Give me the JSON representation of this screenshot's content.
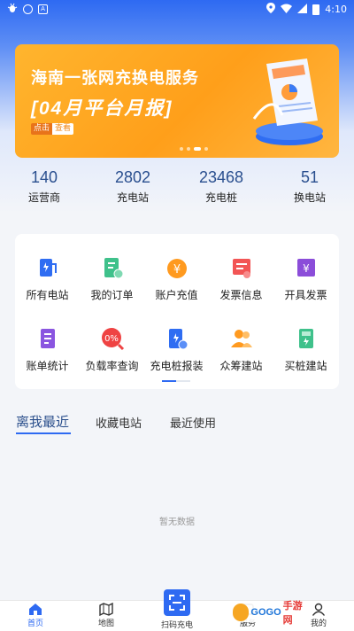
{
  "status_bar": {
    "left_icons": [
      "bug-icon",
      "circle-app-icon",
      "a-notification-icon"
    ],
    "right_icons": [
      "location-icon",
      "wifi-icon",
      "signal-icon",
      "battery-icon"
    ],
    "time": "4:10"
  },
  "banner": {
    "title": "海南一张网充换电服务",
    "subtitle": "[04月平台月报]",
    "tag_left": "点击",
    "tag_right": "查看",
    "slide_count": 4,
    "active_slide": 3
  },
  "stats": [
    {
      "value": "140",
      "label": "运营商"
    },
    {
      "value": "2802",
      "label": "充电站"
    },
    {
      "value": "23468",
      "label": "充电桩"
    },
    {
      "value": "51",
      "label": "换电站"
    }
  ],
  "menu": {
    "items": [
      {
        "label": "所有电站",
        "icon": "charging-station-icon",
        "color": "#2f6df2"
      },
      {
        "label": "我的订单",
        "icon": "order-icon",
        "color": "#3fc18b"
      },
      {
        "label": "账户充值",
        "icon": "yuan-coin-icon",
        "color": "#ff9a1f"
      },
      {
        "label": "发票信息",
        "icon": "invoice-icon",
        "color": "#f25555"
      },
      {
        "label": "开具发票",
        "icon": "issue-invoice-icon",
        "color": "#8b4dd9"
      },
      {
        "label": "账单统计",
        "icon": "bill-stats-icon",
        "color": "#8a55e0"
      },
      {
        "label": "负载率查询",
        "icon": "percent-icon",
        "color": "#ef4343"
      },
      {
        "label": "充电桩报装",
        "icon": "pile-install-icon",
        "color": "#2f6df2"
      },
      {
        "label": "众筹建站",
        "icon": "crowdfund-users-icon",
        "color": "#ff9a1f"
      },
      {
        "label": "买桩建站",
        "icon": "buy-pile-icon",
        "color": "#3fc18b"
      }
    ],
    "page_count": 2,
    "active_page": 1
  },
  "tabs": [
    {
      "label": "离我最近",
      "active": true
    },
    {
      "label": "收藏电站",
      "active": false
    },
    {
      "label": "最近使用",
      "active": false
    }
  ],
  "empty_text": "暂无数据",
  "bottom_nav": [
    {
      "label": "首页",
      "icon": "home-icon",
      "active": true
    },
    {
      "label": "地图",
      "icon": "map-icon",
      "active": false
    },
    {
      "label": "扫码充电",
      "icon": "scan-icon",
      "active": false
    },
    {
      "label": "服务",
      "icon": "service-icon",
      "active": false
    },
    {
      "label": "我的",
      "icon": "user-icon",
      "active": false
    }
  ],
  "watermark": {
    "text_a": "GOGO",
    "text_b": "手游网"
  },
  "colors": {
    "primary": "#2e6af2",
    "banner": "#ffa82a",
    "stat_number": "#2a4f8f"
  }
}
